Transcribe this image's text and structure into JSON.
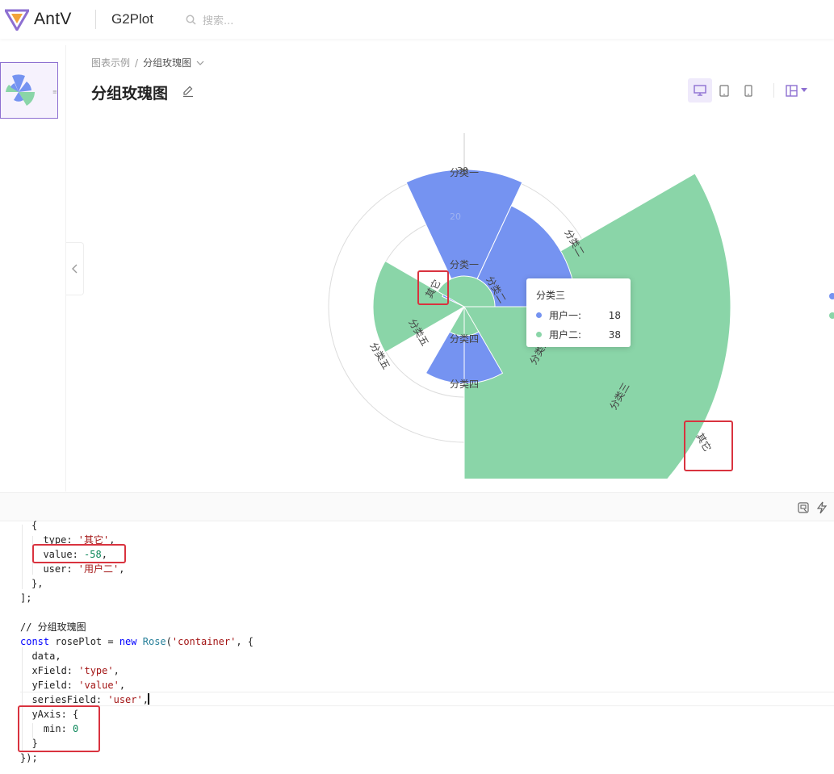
{
  "header": {
    "logo_text": "AntV",
    "product": "G2Plot",
    "search_placeholder": "搜索..."
  },
  "breadcrumb": {
    "root": "图表示例",
    "separator": "/",
    "current": "分组玫瑰图"
  },
  "page_title": "分组玫瑰图",
  "colors": {
    "series1": "#7593f1",
    "series2": "#8ad5a8",
    "accent": "#8d6fd1",
    "annotation": "#d9333f"
  },
  "chart_data": {
    "type": "rose",
    "categories": [
      "分类一",
      "分类二",
      "分类三",
      "分类四",
      "分类五",
      "其它"
    ],
    "series": [
      {
        "name": "用户一",
        "values": [
          27.5,
          25.0,
          18.0,
          15.0,
          8.0,
          5.0
        ]
      },
      {
        "name": "用户二",
        "values": [
          6.0,
          6.0,
          38.0,
          6.0,
          17.0,
          -58.0
        ]
      }
    ],
    "radial_ticks": [
      "30",
      "20"
    ],
    "ylim": [
      0,
      30
    ],
    "grid": true,
    "tooltip": {
      "title": "分类三",
      "rows": [
        {
          "name": "用户一:",
          "value": "18"
        },
        {
          "name": "用户二:",
          "value": "38"
        }
      ]
    }
  },
  "chart_labels": {
    "outer_c1": "分类一",
    "outer_c2": "分类二",
    "outer_c3": "分类三",
    "outer_c4": "分类四",
    "outer_c5": "分类五",
    "outer_other": "其它",
    "inner_c1": "分类一",
    "inner_c2": "分类二",
    "inner_c3": "分类三",
    "inner_c4": "分类四",
    "inner_c5": "分类五",
    "inner_other": "其它"
  },
  "code": {
    "l1": "{",
    "l2a": "  type: ",
    "l2b": "'其它'",
    "l2c": ",",
    "l3a": "  value: ",
    "l3b": "-58",
    "l3c": ",",
    "l4a": "  user: ",
    "l4b": "'用户二'",
    "l4c": ",",
    "l5": "},",
    "l6": "];",
    "l8": "// 分组玫瑰图",
    "l9a": "const",
    "l9b": " rosePlot = ",
    "l9c": "new",
    "l9d": " Rose",
    "l9e": "(",
    "l9f": "'container'",
    "l9g": ", {",
    "l10": "  data,",
    "l11a": "  xField: ",
    "l11b": "'type'",
    "l11c": ",",
    "l12a": "  yField: ",
    "l12b": "'value'",
    "l12c": ",",
    "l13a": "  seriesField: ",
    "l13b": "'user'",
    "l13c": ",",
    "l14": "  yAxis: {",
    "l15a": "    min: ",
    "l15b": "0",
    "l16": "  }",
    "l17": "});"
  }
}
